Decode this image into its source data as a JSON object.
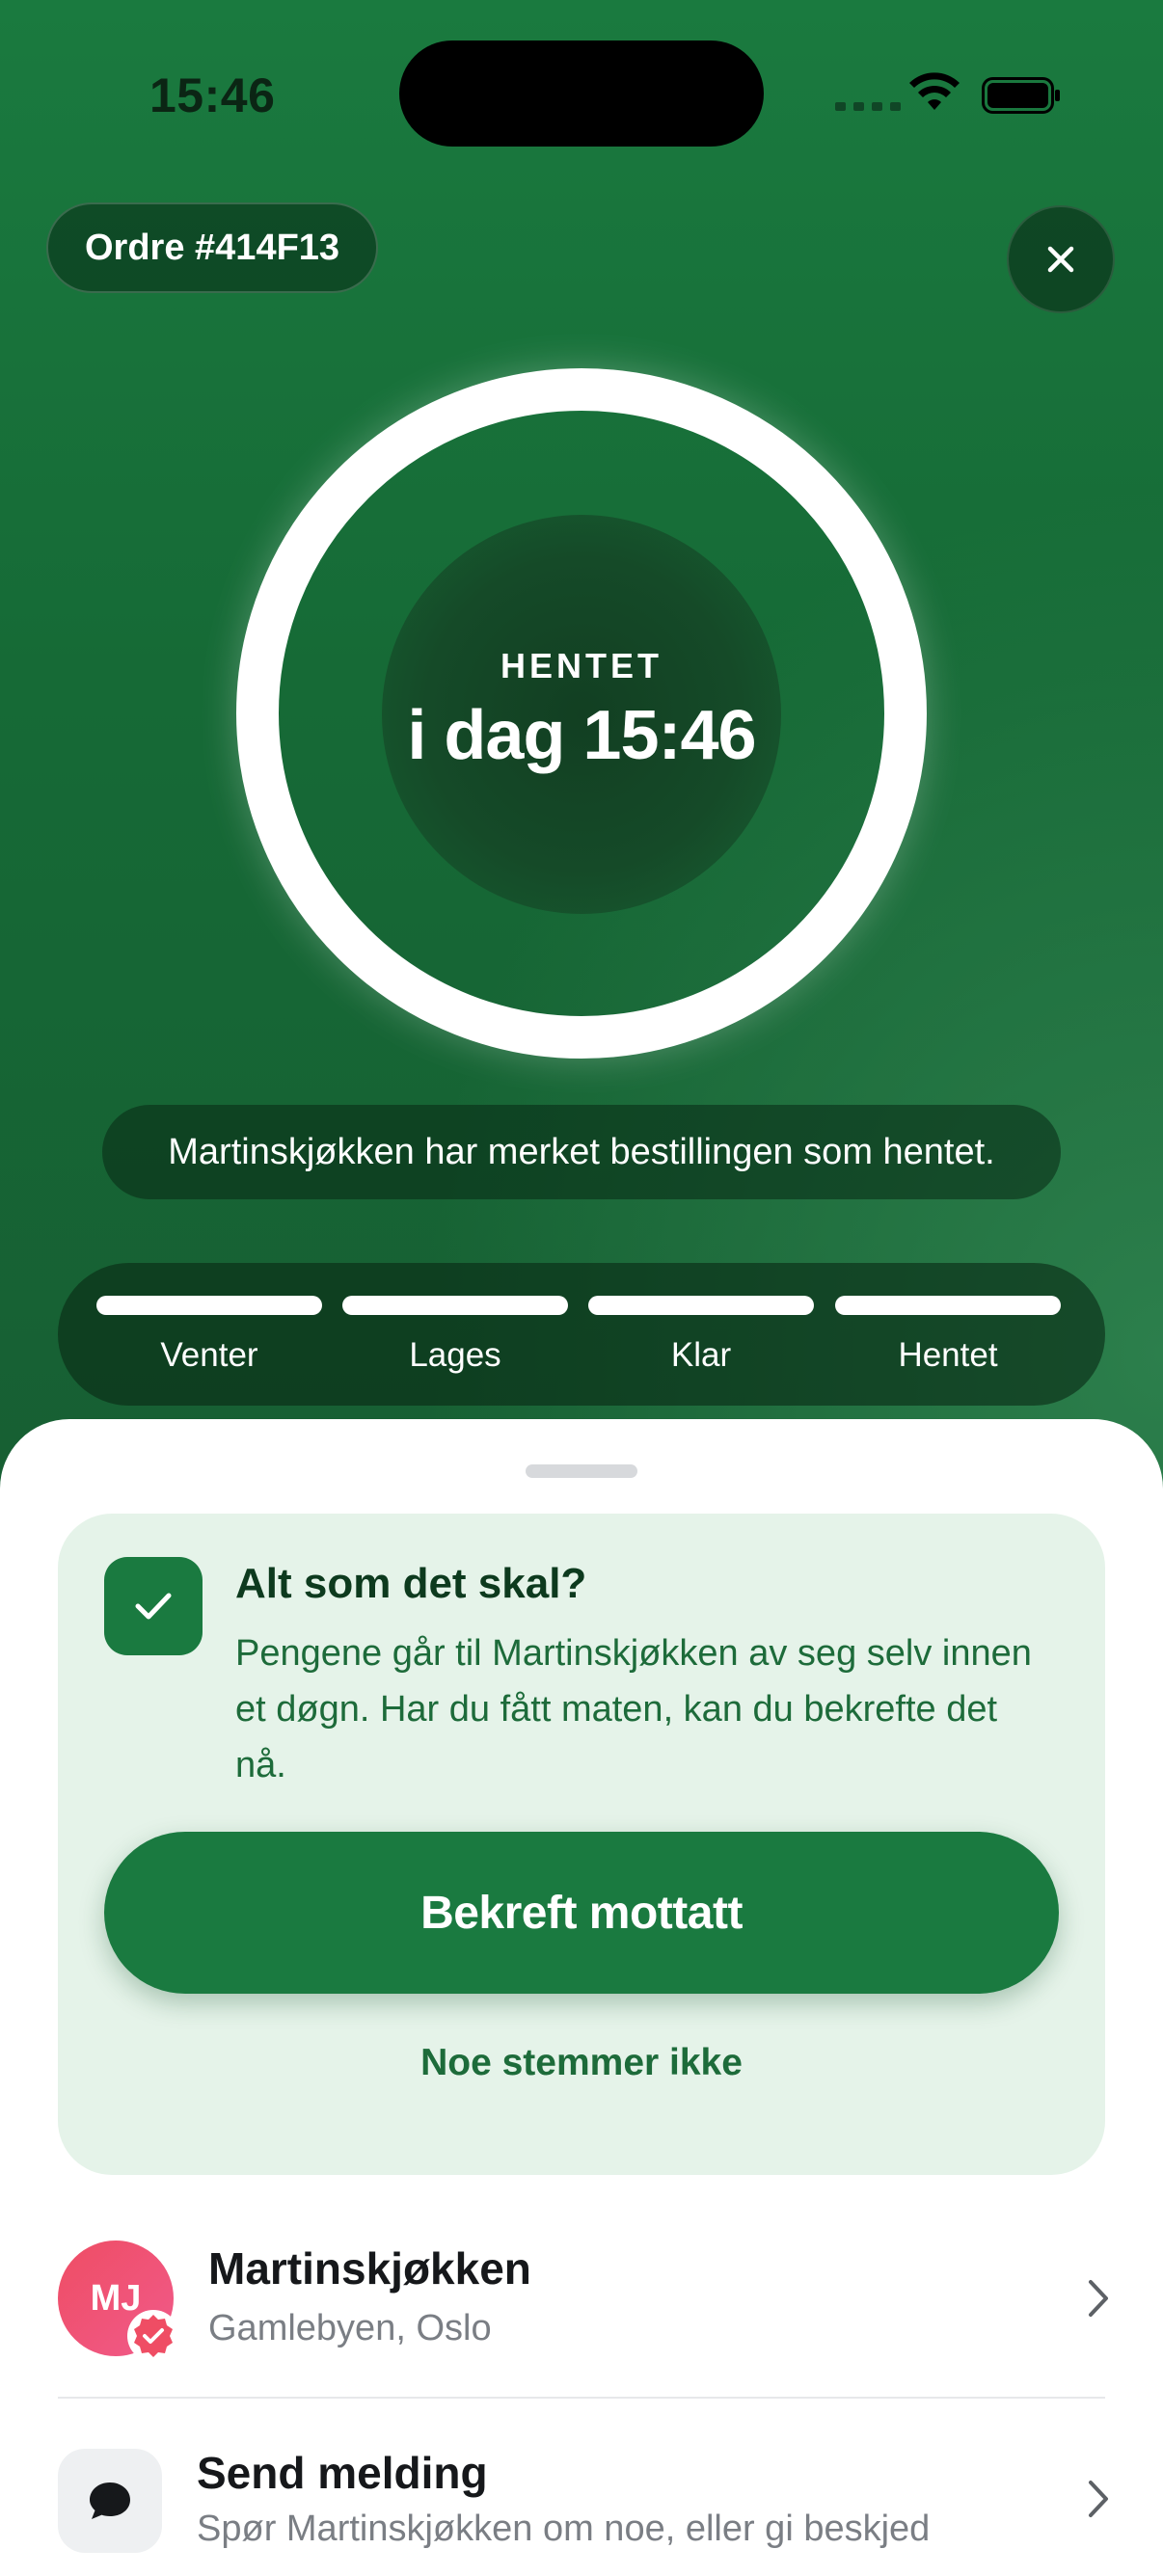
{
  "status_bar": {
    "time": "15:46"
  },
  "header": {
    "order_label": "Ordre #414F13"
  },
  "status_ring": {
    "label": "HENTET",
    "time": "i dag 15:46",
    "progress": 1.0
  },
  "notice": "Martinskjøkken har merket bestillingen som hentet.",
  "progress_steps": [
    {
      "label": "Venter",
      "done": true
    },
    {
      "label": "Lages",
      "done": true
    },
    {
      "label": "Klar",
      "done": true
    },
    {
      "label": "Hentet",
      "done": true
    }
  ],
  "confirm_card": {
    "title": "Alt som det skal?",
    "body": "Pengene går til Martinskjøkken av seg selv innen et døgn. Har du fått maten, kan du bekrefte det nå.",
    "confirm_button": "Bekreft mottatt",
    "problem_link": "Noe stemmer ikke"
  },
  "vendor": {
    "initials": "MJ",
    "name": "Martinskjøkken",
    "location": "Gamlebyen, Oslo"
  },
  "message": {
    "title": "Send melding",
    "subtitle": "Spør Martinskjøkken om noe, eller gi beskjed"
  },
  "colors": {
    "brand_green": "#1a7a40",
    "card_bg": "#e5f3e9",
    "avatar_pink": "#ef4d64"
  }
}
